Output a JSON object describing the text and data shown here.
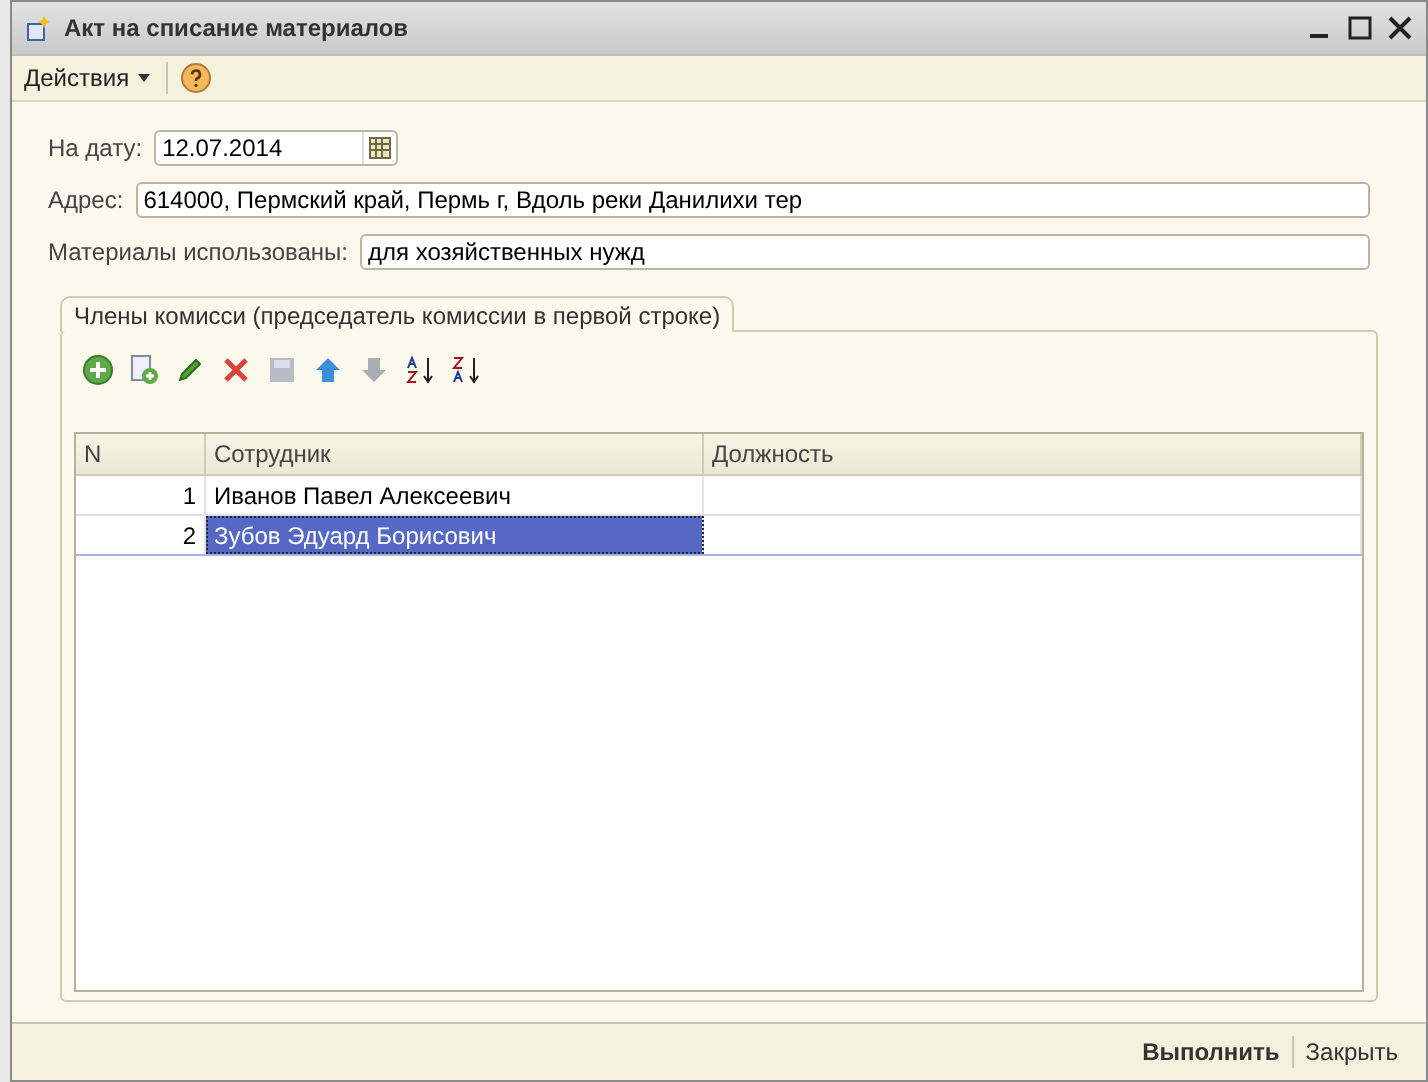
{
  "window": {
    "title": "Акт на списание материалов"
  },
  "toolbar": {
    "actions_menu": "Действия"
  },
  "fields": [
    {
      "label": "На дату:",
      "value": "12.07.2014",
      "kind": "date"
    },
    {
      "label": "Адрес:",
      "value": "614000, Пермский край, Пермь г, Вдоль реки Данилихи тер",
      "kind": "text"
    },
    {
      "label": "Материалы использованы:",
      "value": "для хозяйственных нужд",
      "kind": "text"
    }
  ],
  "tab": {
    "label": "Члены комисси (председатель комиссии в первой строке)",
    "selected": true
  },
  "table": {
    "columns": [
      "N",
      "Сотрудник",
      "Должность"
    ],
    "rows": [
      {
        "n": "1",
        "employee": "Иванов Павел Алексеевич",
        "selected": false
      },
      {
        "n": "2",
        "employee": "Зубов Эдуард Борисович",
        "selected": true
      }
    ]
  },
  "footer": {
    "buttons": [
      {
        "label": "Выполнить",
        "kind": "default"
      },
      {
        "label": "Закрыть",
        "kind": "plain"
      }
    ]
  }
}
